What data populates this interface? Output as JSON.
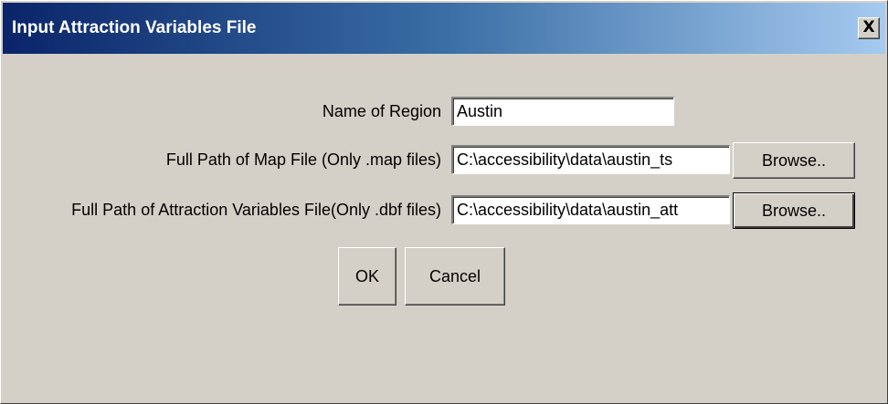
{
  "window": {
    "title": "Input Attraction Variables File",
    "close_glyph": "X"
  },
  "form": {
    "region": {
      "label": "Name of Region",
      "value": "Austin"
    },
    "map_file": {
      "label": "Full Path of Map File (Only .map files)",
      "value": "C:\\accessibility\\data\\austin_ts",
      "browse_label": "Browse.."
    },
    "attraction_file": {
      "label": "Full Path of Attraction Variables File(Only .dbf files)",
      "value": "C:\\accessibility\\data\\austin_att",
      "browse_label": "Browse.."
    }
  },
  "actions": {
    "ok_label": "OK",
    "cancel_label": "Cancel"
  },
  "colors": {
    "dialog_bg": "#d4d0c8",
    "titlebar_start": "#0a246a",
    "titlebar_end": "#a6caf0"
  }
}
